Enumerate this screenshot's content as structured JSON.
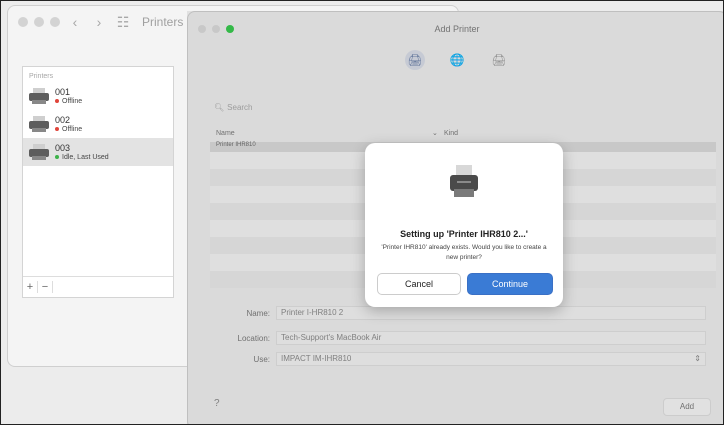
{
  "background_window": {
    "title": "Printers",
    "back_glyph": "‹",
    "forward_glyph": "›",
    "grid_glyph": "☷",
    "sidebar_header": "Printers",
    "printers": [
      {
        "name": "001",
        "status": "Offline",
        "status_color": "#e0443a"
      },
      {
        "name": "002",
        "status": "Offline",
        "status_color": "#e0443a"
      },
      {
        "name": "003",
        "status": "Idle, Last Used",
        "status_color": "#3cb34a"
      }
    ],
    "add_label": "+",
    "remove_label": "−"
  },
  "sheet": {
    "title": "Add Printer",
    "traffic_lights": [
      "#d9d9d9",
      "#d9d9d9",
      "#34c84a"
    ],
    "search_placeholder": "Search",
    "col_name": "Name",
    "col_kind": "Kind",
    "selected_row": "Printer IHR810",
    "form": {
      "name_label": "Name:",
      "name_value": "Printer I-HR810 2",
      "location_label": "Location:",
      "location_value": "Tech-Support's MacBook Air",
      "use_label": "Use:",
      "use_value": "IMPACT IM-IHR810",
      "use_chevron": "⌃⌄"
    },
    "help_label": "?",
    "add_label": "Add"
  },
  "alert": {
    "title": "Setting up 'Printer IHR810 2...'",
    "message": "'Printer IHR810' already exists. Would you like to create a new printer?",
    "cancel_label": "Cancel",
    "continue_label": "Continue"
  }
}
